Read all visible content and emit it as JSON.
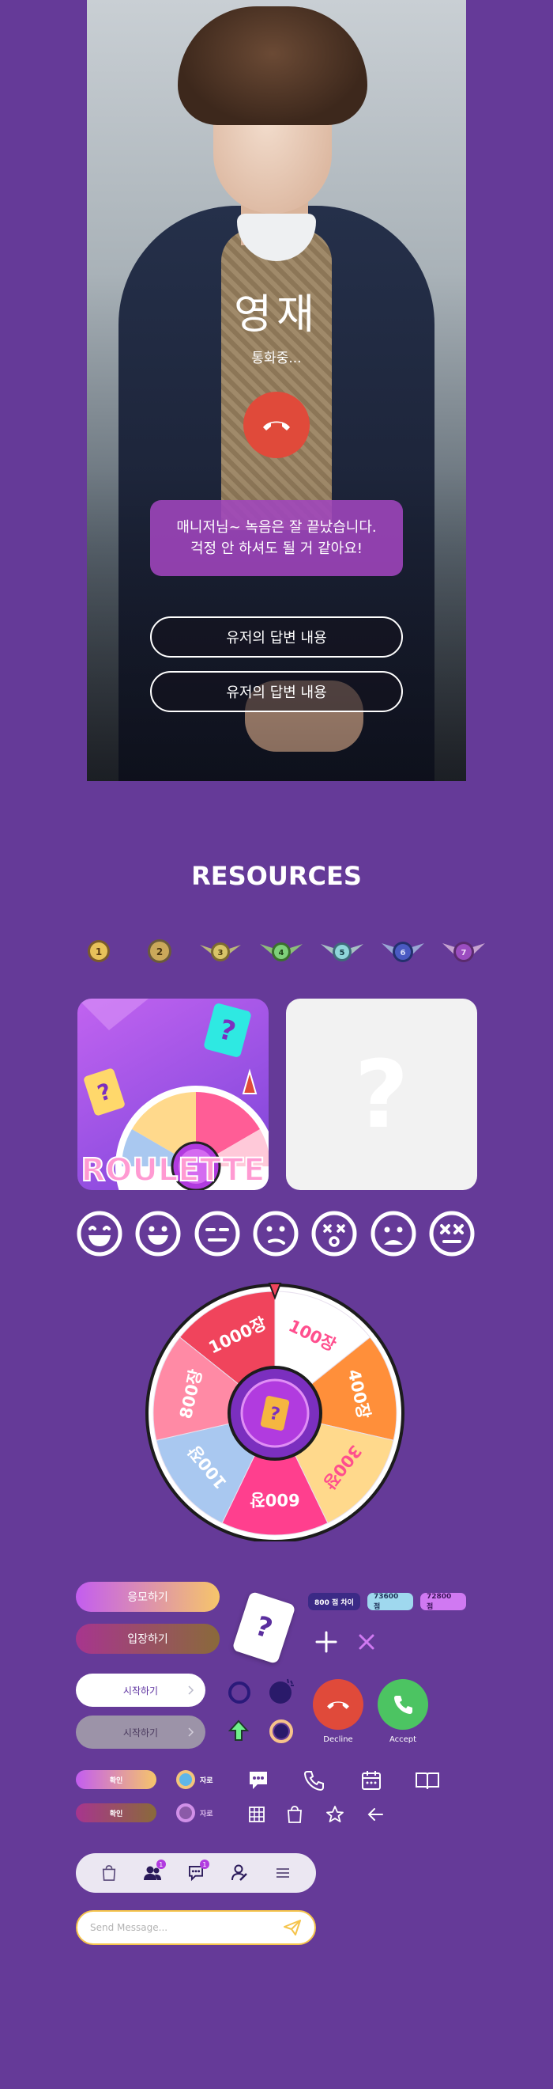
{
  "call": {
    "caller_name": "영재",
    "status": "통화중...",
    "message": "매니저님~ 녹음은 잘 끝났습니다.\n걱정 안 하셔도 될 거 같아요!",
    "replies": [
      "유저의 답변 내용",
      "유저의 답변 내용"
    ]
  },
  "resources": {
    "title": "RESOURCES",
    "badges": [
      "1",
      "2",
      "3",
      "4",
      "5",
      "6",
      "7"
    ],
    "roulette_card": {
      "text": "ROULETTE",
      "question": "?"
    },
    "unknown_card": {
      "text": "?"
    },
    "emoji_icons": [
      "laughing-face-icon",
      "smile-face-icon",
      "neutral-face-icon",
      "smirk-face-icon",
      "dizzy-face-icon",
      "sad-face-icon",
      "dead-face-icon"
    ],
    "wheel": {
      "segments": [
        "1000장",
        "100장",
        "400장",
        "300장",
        "600장",
        "100장",
        "800장"
      ],
      "colors": [
        "#f0445c",
        "#ffffff",
        "#ff8f3a",
        "#ffd98c",
        "#ff3f8e",
        "#a9c8f0",
        "#ff8aa5"
      ],
      "center": "?"
    },
    "buttons": {
      "apply": "응모하기",
      "enter": "입장하기",
      "start_active": "시작하기",
      "start_disabled": "시작하기",
      "confirm": "확인",
      "confirm2": "확인",
      "profile_label": "자로",
      "profile_label2": "자로"
    },
    "card_question": "?",
    "chips": [
      "800 점 차이",
      "73600 점",
      "72800 점"
    ],
    "call_buttons": {
      "decline": "Decline",
      "accept": "Accept"
    },
    "send_placeholder": "Send Message...",
    "nav_badges": [
      "1",
      "1"
    ],
    "colors": {
      "background": "#653a98",
      "decline": "#e04a3a",
      "accept": "#4cc462",
      "accent_gold": "#f5c44c",
      "accent_purple": "#b13bdf"
    }
  }
}
